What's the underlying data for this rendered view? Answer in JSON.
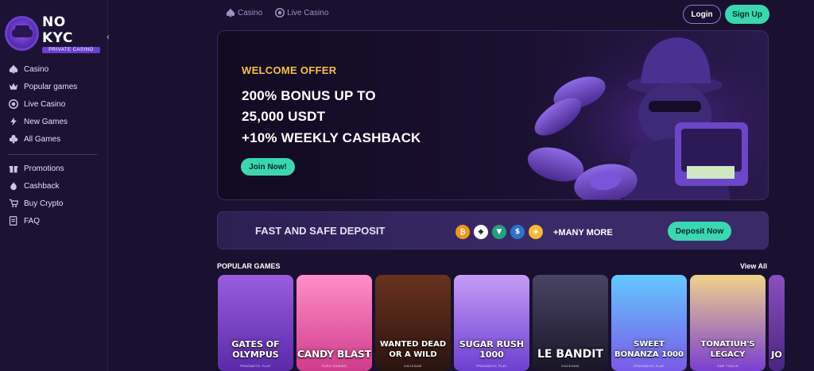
{
  "brand": {
    "name": "NO KYC",
    "tagline": "PRIVATE CASINO"
  },
  "sidebar": {
    "items": [
      {
        "label": "Casino",
        "icon": "spade-icon"
      },
      {
        "label": "Popular games",
        "icon": "crown-icon"
      },
      {
        "label": "Live Casino",
        "icon": "chip-icon"
      },
      {
        "label": "New Games",
        "icon": "lightning-icon"
      },
      {
        "label": "All Games",
        "icon": "club-icon"
      }
    ],
    "secondary": [
      {
        "label": "Promotions",
        "icon": "gift-icon"
      },
      {
        "label": "Cashback",
        "icon": "flame-icon"
      },
      {
        "label": "Buy Crypto",
        "icon": "cart-icon"
      },
      {
        "label": "FAQ",
        "icon": "faq-icon"
      }
    ],
    "collapse_glyph": "‹"
  },
  "topnav": {
    "casino": "Casino",
    "live_casino": "Live Casino"
  },
  "auth": {
    "login": "Login",
    "signup": "Sign Up"
  },
  "hero": {
    "eyebrow": "WELCOME OFFER",
    "line1": "200% BONUS UP TO",
    "line2": "25,000 USDT",
    "line3": "+10% WEEKLY CASHBACK",
    "cta": "Join Now!"
  },
  "deposit": {
    "title": "FAST AND SAFE DEPOSIT",
    "coins": [
      {
        "symbol": "₿",
        "color": "#f7931a",
        "name": "bitcoin-icon"
      },
      {
        "symbol": "◆",
        "color": "#ffffff",
        "name": "ethereum-icon"
      },
      {
        "symbol": "▼",
        "color": "#26a17b",
        "name": "tether-icon"
      },
      {
        "symbol": "$",
        "color": "#2775ca",
        "name": "usdc-icon"
      },
      {
        "symbol": "◈",
        "color": "#f3ba2f",
        "name": "bnb-icon"
      }
    ],
    "more": "+MANY MORE",
    "cta": "Deposit Now"
  },
  "popular": {
    "title": "POPULAR GAMES",
    "view_all": "View All",
    "games": [
      {
        "name": "GATES OF OLYMPUS",
        "provider": "PRAGMATIC PLAY",
        "colors": [
          "#9a5de0",
          "#5a2aa8"
        ]
      },
      {
        "name": "CANDY BLAST",
        "provider": "PUSH GAMING",
        "colors": [
          "#ff6fb5",
          "#d03c8c"
        ]
      },
      {
        "name": "WANTED DEAD OR A WILD",
        "provider": "HACKSAW",
        "colors": [
          "#5a2a1e",
          "#2a1410"
        ]
      },
      {
        "name": "SUGAR RUSH 1000",
        "provider": "PRAGMATIC PLAY",
        "colors": [
          "#b07ff0",
          "#6c3fd0"
        ]
      },
      {
        "name": "LE BANDIT",
        "provider": "HACKSAW",
        "colors": [
          "#3a3550",
          "#1a1628"
        ]
      },
      {
        "name": "SWEET BONANZA 1000",
        "provider": "PRAGMATIC PLAY",
        "colors": [
          "#63c8ff",
          "#7a5ae8"
        ]
      },
      {
        "name": "TONATIUH'S LEGACY",
        "provider": "ONE TOUCH",
        "colors": [
          "#f2d28a",
          "#7a3fd0"
        ]
      },
      {
        "name": "JO",
        "provider": "",
        "colors": [
          "#8a4fc0",
          "#4a2680"
        ]
      }
    ]
  }
}
